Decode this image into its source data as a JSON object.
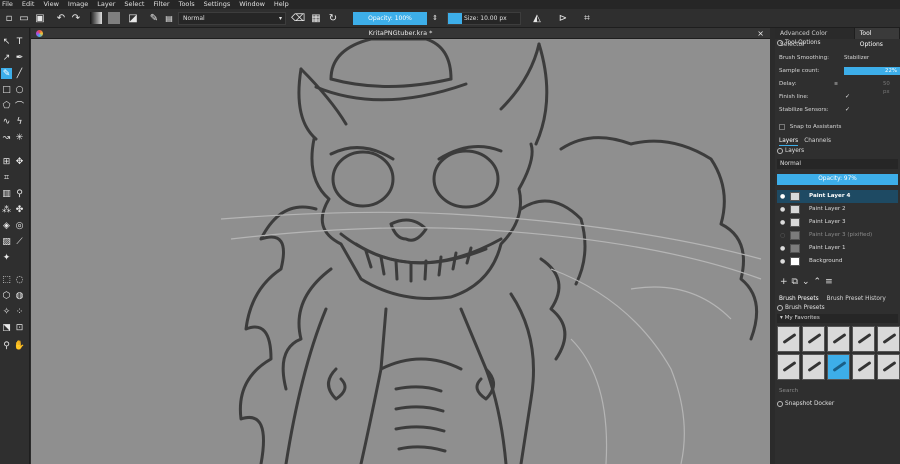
{
  "menu": [
    "File",
    "Edit",
    "View",
    "Image",
    "Layer",
    "Select",
    "Filter",
    "Tools",
    "Settings",
    "Window",
    "Help"
  ],
  "toolbar": {
    "blend_mode": "Normal",
    "opacity_label": "Opacity: 100%",
    "size_label": "Size: 10.00 px"
  },
  "document": {
    "title": "KritaPNGtuber.kra *",
    "close": "×"
  },
  "dock": {
    "tabs": [
      "Advanced Color Selector",
      "Tool Options"
    ],
    "tool_options_header": "Tool Options",
    "brush_smoothing_label": "Brush Smoothing:",
    "brush_smoothing_value": "Stabilizer",
    "sample_count_label": "Sample count:",
    "sample_count_value": "22%",
    "delay_label": "Delay:",
    "delay_value": "50 px",
    "finish_line_label": "Finish line:",
    "stabilize_sensors_label": "Stabilize Sensors:",
    "snap_label": "Snap to Assistants",
    "layer_tabs": [
      "Layers",
      "Channels"
    ],
    "layers_header": "Layers",
    "layers_blend": "Normal",
    "layers_opacity": "Opacity:  97%",
    "layers": [
      {
        "name": "Paint Layer 4",
        "selected": true
      },
      {
        "name": "Paint Layer 2",
        "selected": false
      },
      {
        "name": "Paint Layer 3",
        "selected": false
      },
      {
        "name": "Paint Layer 3 (pixified)",
        "selected": false
      },
      {
        "name": "Paint Layer 1",
        "selected": false
      },
      {
        "name": "Background",
        "selected": false
      }
    ],
    "preset_tabs": [
      "Brush Presets",
      "Brush Preset History"
    ],
    "presets_header": "Brush Presets",
    "presets_tag": "My Favorites",
    "search_placeholder": "Search",
    "snapshot_header": "Snapshot Docker"
  },
  "colors": {
    "accent": "#3daee9",
    "canvas": "#8f8f8f",
    "panel": "#2f2f2f"
  }
}
